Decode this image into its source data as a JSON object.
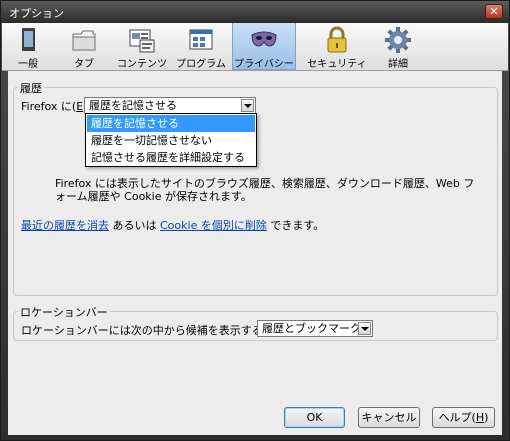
{
  "window": {
    "title": "オプション"
  },
  "tabs": [
    {
      "label": "一般",
      "icon": "general-icon"
    },
    {
      "label": "タブ",
      "icon": "tabs-icon"
    },
    {
      "label": "コンテンツ",
      "icon": "content-icon"
    },
    {
      "label": "プログラム",
      "icon": "applications-icon"
    },
    {
      "label": "プライバシー",
      "icon": "privacy-mask-icon",
      "active": true
    },
    {
      "label": "セキュリティ",
      "icon": "lock-icon"
    },
    {
      "label": "詳細",
      "icon": "gear-icon"
    }
  ],
  "history": {
    "group_label": "履歴",
    "firefox_label": "Firefox に(",
    "firefox_access_key": "E",
    "firefox_label_end": "):",
    "selected": "履歴を記憶させる",
    "options": [
      "履歴を記憶させる",
      "履歴を一切記憶させない",
      "記憶させる履歴を詳細設定する"
    ],
    "description": "Firefox には表示したサイトのブラウズ履歴、検索履歴、ダウンロード履歴、Web フォーム履歴や Cookie が保存されます。",
    "clear_link": "最近の履歴を消去",
    "middle_text": "あるいは",
    "cookie_link": "Cookie を個別に削除",
    "tail_text": "できます。"
  },
  "location_bar": {
    "group_label": "ロケーションバー",
    "label": "ロケーションバーには次の中から候補を表示する(",
    "access_key": "L",
    "label_end": "):",
    "selected": "履歴とブックマーク"
  },
  "buttons": {
    "ok": "OK",
    "cancel": "キャンセル",
    "help_prefix": "ヘルプ(",
    "help_key": "H",
    "help_suffix": ")"
  },
  "colors": {
    "accent": "#3399ff",
    "link": "#0645ad"
  }
}
